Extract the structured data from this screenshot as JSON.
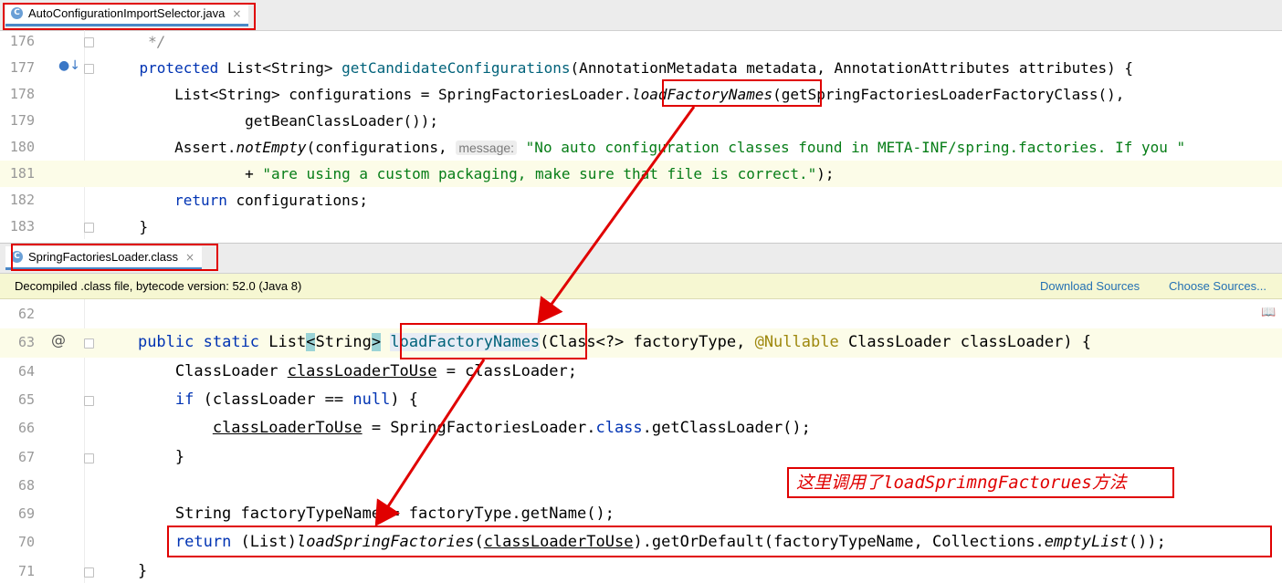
{
  "pane1": {
    "tab_title": "AutoConfigurationImportSelector.java",
    "lines": [
      {
        "num": "176",
        "tokens": [
          {
            "t": "     */",
            "c": "cm"
          }
        ]
      },
      {
        "num": "177",
        "tokens": [
          {
            "t": "    "
          },
          {
            "t": "protected",
            "c": "kw"
          },
          {
            "t": " List<String> "
          },
          {
            "t": "getCandidateConfigurations",
            "c": "fn"
          },
          {
            "t": "(AnnotationMetadata metadata, AnnotationAttributes attributes) {"
          }
        ]
      },
      {
        "num": "178",
        "tokens": [
          {
            "t": "        List<String> configurations = SpringFactoriesLoader."
          },
          {
            "t": "loadFactoryNames",
            "c": "itfn"
          },
          {
            "t": "(getSpringFactoriesLoaderFactoryClass(),"
          }
        ]
      },
      {
        "num": "179",
        "tokens": [
          {
            "t": "                getBeanClassLoader());"
          }
        ]
      },
      {
        "num": "180",
        "tokens": [
          {
            "t": "        Assert."
          },
          {
            "t": "notEmpty",
            "c": "it"
          },
          {
            "t": "(configurations, "
          },
          {
            "t": "message:",
            "c": "hintlbl"
          },
          {
            "t": " "
          },
          {
            "t": "\"No auto configuration classes found in META-INF/spring.factories. If you \"",
            "c": "str"
          }
        ]
      },
      {
        "num": "181",
        "tokens": [
          {
            "t": "                + "
          },
          {
            "t": "\"are using a custom packaging, make sure that file is correct.\"",
            "c": "str"
          },
          {
            "t": ");"
          }
        ]
      },
      {
        "num": "182",
        "tokens": [
          {
            "t": "        "
          },
          {
            "t": "return",
            "c": "kw"
          },
          {
            "t": " configurations;"
          }
        ]
      },
      {
        "num": "183",
        "tokens": [
          {
            "t": "    }"
          }
        ]
      }
    ]
  },
  "pane2": {
    "tab_title": "SpringFactoriesLoader.class",
    "notice": {
      "message": "Decompiled .class file, bytecode version: 52.0 (Java 8)",
      "download_sources": "Download Sources",
      "choose_sources": "Choose Sources..."
    },
    "lines": [
      {
        "num": "62",
        "tokens": []
      },
      {
        "num": "63",
        "tokens": [
          {
            "t": "    "
          },
          {
            "t": "public",
            "c": "kw"
          },
          {
            "t": " "
          },
          {
            "t": "static",
            "c": "kw"
          },
          {
            "t": " List"
          },
          {
            "t": "<",
            "c": "brk"
          },
          {
            "t": "String"
          },
          {
            "t": ">",
            "c": "brk"
          },
          {
            "t": " "
          },
          {
            "t": "loadFactoryNames",
            "c": "fnhl"
          },
          {
            "t": "(Class<?> factoryType, "
          },
          {
            "t": "@Nullable",
            "c": "ann"
          },
          {
            "t": " ClassLoader classLoader) {"
          }
        ]
      },
      {
        "num": "64",
        "tokens": [
          {
            "t": "        ClassLoader "
          },
          {
            "t": "classLoaderToUse",
            "c": "ul"
          },
          {
            "t": " = classLoader;"
          }
        ]
      },
      {
        "num": "65",
        "tokens": [
          {
            "t": "        "
          },
          {
            "t": "if",
            "c": "kw"
          },
          {
            "t": " (classLoader == "
          },
          {
            "t": "null",
            "c": "kw"
          },
          {
            "t": ") {"
          }
        ]
      },
      {
        "num": "66",
        "tokens": [
          {
            "t": "            "
          },
          {
            "t": "classLoaderToUse",
            "c": "ul"
          },
          {
            "t": " = SpringFactoriesLoader."
          },
          {
            "t": "class",
            "c": "kw"
          },
          {
            "t": ".getClassLoader();"
          }
        ]
      },
      {
        "num": "67",
        "tokens": [
          {
            "t": "        }"
          }
        ]
      },
      {
        "num": "68",
        "tokens": []
      },
      {
        "num": "69",
        "tokens": [
          {
            "t": "        String factoryTypeName = factoryType.getName();"
          }
        ]
      },
      {
        "num": "70",
        "tokens": [
          {
            "t": "        "
          },
          {
            "t": "return",
            "c": "kw"
          },
          {
            "t": " (List)"
          },
          {
            "t": "loadSpringFactories",
            "c": "it"
          },
          {
            "t": "("
          },
          {
            "t": "classLoaderToUse",
            "c": "ul"
          },
          {
            "t": ").getOrDefault(factoryTypeName, Collections."
          },
          {
            "t": "emptyList",
            "c": "it"
          },
          {
            "t": "());"
          }
        ]
      },
      {
        "num": "71",
        "tokens": [
          {
            "t": "    }"
          }
        ]
      }
    ]
  },
  "annotation_text": "这里调用了loadSprimngFactorues方法",
  "colors": {
    "highlight_red": "#e00000",
    "keyword": "#0033b3",
    "string": "#067d17",
    "function": "#00627a"
  }
}
